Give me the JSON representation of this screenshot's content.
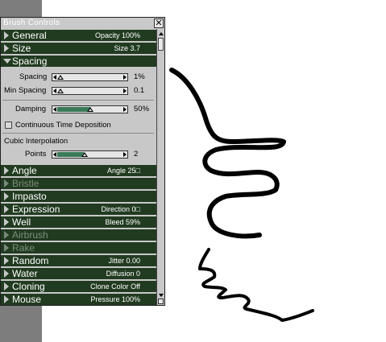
{
  "panel": {
    "title": "Brush Controls",
    "close_label": "✕"
  },
  "sections": [
    {
      "id": "general",
      "label": "General",
      "value": "Opacity 100%",
      "enabled": true,
      "expanded": false
    },
    {
      "id": "size",
      "label": "Size",
      "value": "Size 3.7",
      "enabled": true,
      "expanded": false
    },
    {
      "id": "spacing",
      "label": "Spacing",
      "value": "",
      "enabled": true,
      "expanded": true
    },
    {
      "id": "angle",
      "label": "Angle",
      "value": "Angle 25□",
      "enabled": true,
      "expanded": false
    },
    {
      "id": "bristle",
      "label": "Bristle",
      "value": "",
      "enabled": false,
      "expanded": false
    },
    {
      "id": "impasto",
      "label": "Impasto",
      "value": "",
      "enabled": true,
      "expanded": false
    },
    {
      "id": "expression",
      "label": "Expression",
      "value": "Direction 0□",
      "enabled": true,
      "expanded": false
    },
    {
      "id": "well",
      "label": "Well",
      "value": "Bleed 59%",
      "enabled": true,
      "expanded": false
    },
    {
      "id": "airbrush",
      "label": "Airbrush",
      "value": "",
      "enabled": false,
      "expanded": false
    },
    {
      "id": "rake",
      "label": "Rake",
      "value": "",
      "enabled": false,
      "expanded": false
    },
    {
      "id": "random",
      "label": "Random",
      "value": "Jitter 0.00",
      "enabled": true,
      "expanded": false
    },
    {
      "id": "water",
      "label": "Water",
      "value": "Diffusion 0",
      "enabled": true,
      "expanded": false
    },
    {
      "id": "cloning",
      "label": "Cloning",
      "value": "Clone Color Off",
      "enabled": true,
      "expanded": false
    },
    {
      "id": "mouse",
      "label": "Mouse",
      "value": "Pressure 100%",
      "enabled": true,
      "expanded": false
    }
  ],
  "spacing_controls": {
    "spacing": {
      "label": "Spacing",
      "value": "1%",
      "level": 0.0
    },
    "min_spacing": {
      "label": "Min Spacing",
      "value": "0.1",
      "level": 0.0
    },
    "damping": {
      "label": "Damping",
      "value": "50%",
      "level": 0.5
    },
    "continuous_time_deposition": {
      "label": "Continuous Time Deposition",
      "checked": false
    },
    "cubic_interpolation": {
      "label": "Cubic Interpolation"
    },
    "points": {
      "label": "Points",
      "value": "2",
      "level": 0.4
    }
  },
  "colors": {
    "header_bg": "#213b21",
    "panel_bg": "#c8c8c8",
    "slider_fill": "#3a7a5a",
    "left_strip": "#7d7d7d",
    "stroke": "#000000"
  }
}
